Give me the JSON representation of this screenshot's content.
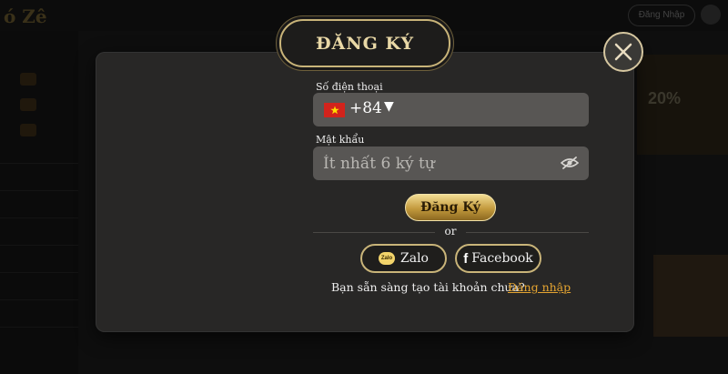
{
  "background": {
    "logo": "ó Zê",
    "login_button": "Đăng Nhập",
    "promo": "20%"
  },
  "modal": {
    "title": "ĐĂNG KÝ",
    "close_icon": "close-icon",
    "phone": {
      "label": "Số điện thoại",
      "country_code": "+84",
      "dropdown_arrow": "▼",
      "flag": "vietnam-flag-icon"
    },
    "password": {
      "label": "Mật khẩu",
      "placeholder": "Ít nhất 6 ký tự",
      "toggle_icon": "eye-slash-icon"
    },
    "submit_label": "Đăng Ký",
    "separator": "or",
    "social": {
      "zalo_label": "Zalo",
      "zalo_icon_text": "Zalo",
      "facebook_label": "Facebook",
      "facebook_icon_text": "f"
    },
    "footer_prompt": "Bạn sẵn sàng tạo tài khoản chưa?",
    "footer_link": "Đăng nhập"
  },
  "colors": {
    "accent_gold": "#c9b479",
    "link_orange": "#e4a431",
    "modal_bg": "#282726",
    "field_bg": "#585654"
  }
}
